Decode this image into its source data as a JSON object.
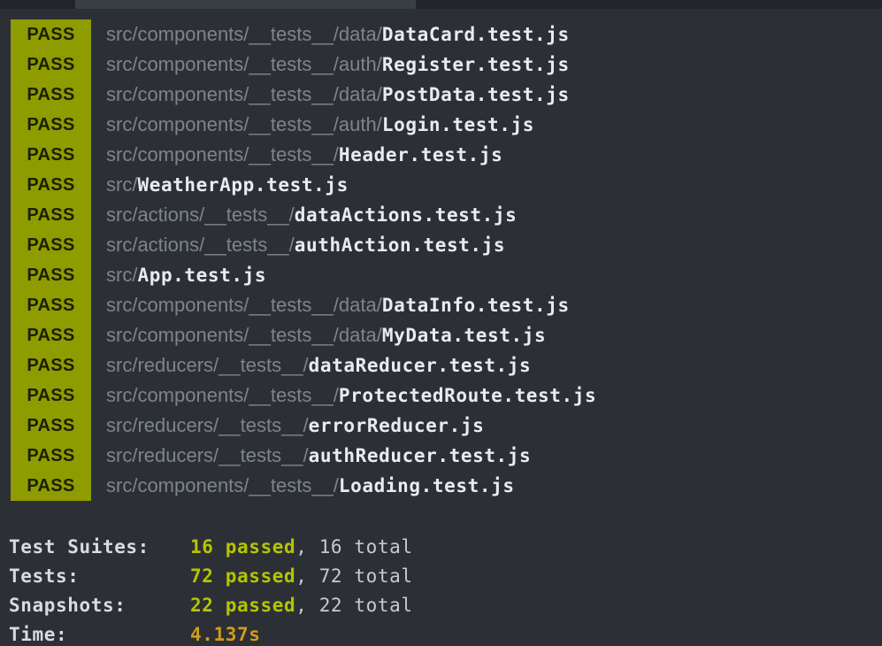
{
  "results": [
    {
      "status": "PASS",
      "dir": "src/components/__tests__/data/",
      "file": "DataCard.test.js"
    },
    {
      "status": "PASS",
      "dir": "src/components/__tests__/auth/",
      "file": "Register.test.js"
    },
    {
      "status": "PASS",
      "dir": "src/components/__tests__/data/",
      "file": "PostData.test.js"
    },
    {
      "status": "PASS",
      "dir": "src/components/__tests__/auth/",
      "file": "Login.test.js"
    },
    {
      "status": "PASS",
      "dir": "src/components/__tests__/",
      "file": "Header.test.js"
    },
    {
      "status": "PASS",
      "dir": "src/",
      "file": "WeatherApp.test.js"
    },
    {
      "status": "PASS",
      "dir": "src/actions/__tests__/",
      "file": "dataActions.test.js"
    },
    {
      "status": "PASS",
      "dir": "src/actions/__tests__/",
      "file": "authAction.test.js"
    },
    {
      "status": "PASS",
      "dir": "src/",
      "file": "App.test.js"
    },
    {
      "status": "PASS",
      "dir": "src/components/__tests__/data/",
      "file": "DataInfo.test.js"
    },
    {
      "status": "PASS",
      "dir": "src/components/__tests__/data/",
      "file": "MyData.test.js"
    },
    {
      "status": "PASS",
      "dir": "src/reducers/__tests__/",
      "file": "dataReducer.test.js"
    },
    {
      "status": "PASS",
      "dir": "src/components/__tests__/",
      "file": "ProtectedRoute.test.js"
    },
    {
      "status": "PASS",
      "dir": "src/reducers/__tests__/",
      "file": "errorReducer.js"
    },
    {
      "status": "PASS",
      "dir": "src/reducers/__tests__/",
      "file": "authReducer.test.js"
    },
    {
      "status": "PASS",
      "dir": "src/components/__tests__/",
      "file": "Loading.test.js"
    }
  ],
  "summary": {
    "suites": {
      "label": "Test Suites:",
      "passed": "16 passed",
      "total": ", 16 total"
    },
    "tests": {
      "label": "Tests:",
      "passed": "72 passed",
      "total": ", 72 total"
    },
    "snapshots": {
      "label": "Snapshots:",
      "passed": "22 passed",
      "total": ", 22 total"
    },
    "time": {
      "label": "Time:",
      "value": "4.137s"
    }
  },
  "colors": {
    "background": "#2c3036",
    "pass_badge": "#8e9c00",
    "passed_text": "#b6c400",
    "time_text": "#d29a1c"
  }
}
